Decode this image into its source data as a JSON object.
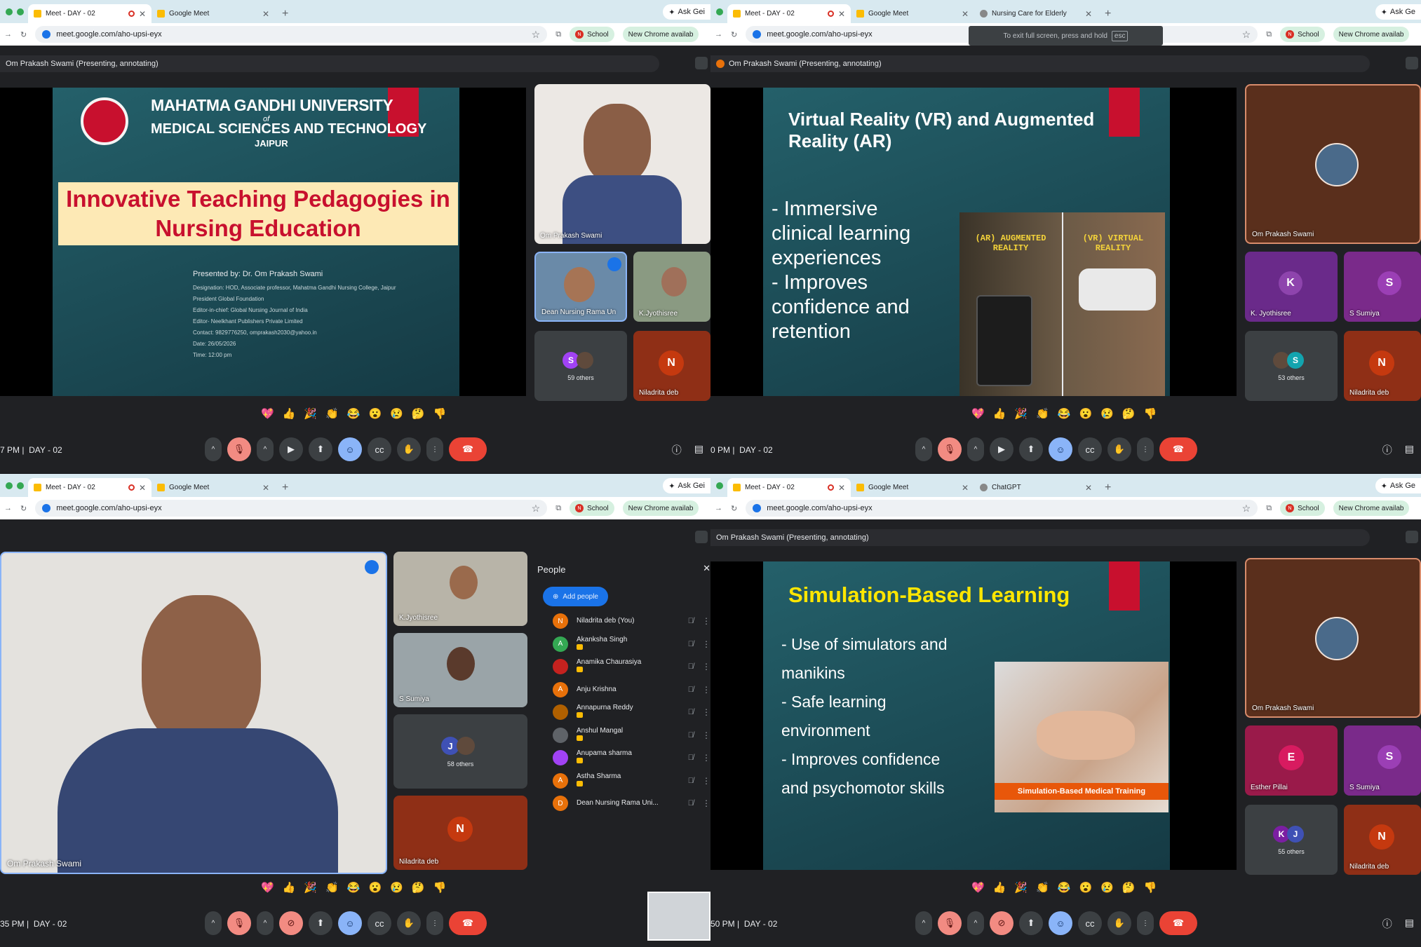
{
  "panes": [
    {
      "tabs": [
        "Meet - DAY - 02",
        "Google Meet"
      ],
      "url": "meet.google.com/aho-upsi-eyx",
      "ask": "Ask Gei",
      "pills": [
        "School",
        "New Chrome availab"
      ],
      "presenting": "Om Prakash Swami (Presenting, annotating)",
      "time": "7 PM",
      "meeting": "DAY - 02",
      "slide": {
        "org1": "MAHATMA GANDHI UNIVERSITY",
        "of": "of",
        "org2": "MEDICAL SCIENCES AND TECHNOLOGY",
        "city": "JAIPUR",
        "title": "Innovative Teaching Pedagogies in Nursing Education",
        "presenter": "Presented by: Dr. Om Prakash Swami",
        "meta": [
          "Designation: HOD, Associate professor, Mahatma Gandhi Nursing College, Jaipur",
          "President Global Foundation",
          "Editor-in-chief: Global Nursing Journal of India",
          "Editor- Neelkhant Publishers Private Limited",
          "Contact: 9829776250, omprakash2030@yahoo.in",
          "Date: 26/05/2026",
          "Time: 12:00 pm"
        ]
      },
      "tiles": {
        "main": "Om Prakash Swami",
        "a": "Dean Nursing Rama Un",
        "b": "K.Jyothisree",
        "others": "59 others",
        "others_letter": "S",
        "n": "Niladrita deb",
        "n_letter": "N"
      }
    },
    {
      "tabs": [
        "Meet - DAY - 02",
        "Google Meet",
        "Nursing Care for Elderly"
      ],
      "url": "meet.google.com/aho-upsi-eyx",
      "ask": "Ask Ge",
      "pills": [
        "School",
        "New Chrome availab"
      ],
      "presenting": "Om Prakash Swami (Presenting, annotating)",
      "time": "0 PM",
      "meeting": "DAY - 02",
      "toast": "To exit full screen, press and hold",
      "toast_key": "esc",
      "slide": {
        "title": "Virtual Reality (VR) and Augmented Reality (AR)",
        "bullets": [
          "- Immersive clinical learning experiences",
          "- Improves confidence and retention"
        ],
        "img_left": "(AR) AUGMENTED REALITY",
        "img_right": "(VR) VIRTUAL REALITY"
      },
      "tiles": {
        "main": "Om Prakash Swami",
        "a": "K. Jyothisree",
        "a_letter": "K",
        "b": "S Sumiya",
        "b_letter": "S",
        "others": "53 others",
        "others_letter": "S",
        "n": "Niladrita deb",
        "n_letter": "N"
      }
    },
    {
      "tabs": [
        "Meet - DAY - 02",
        "Google Meet"
      ],
      "url": "meet.google.com/aho-upsi-eyx",
      "ask": "Ask Gei",
      "pills": [
        "School",
        "New Chrome availab"
      ],
      "time": "35 PM",
      "meeting": "DAY - 02",
      "tiles": {
        "main": "Om Prakash Swami",
        "a": "K.Jyothisree",
        "b": "S Sumiya",
        "others": "58 others",
        "others_letter": "J",
        "n": "Niladrita deb",
        "n_letter": "N"
      },
      "people": {
        "title": "People",
        "add": "Add people",
        "list": [
          {
            "name": "Niladrita deb (You)",
            "letter": "N",
            "color": "#e8710a",
            "host": false
          },
          {
            "name": "Akanksha Singh",
            "letter": "A",
            "color": "#34a853",
            "host": true
          },
          {
            "name": "Anamika Chaurasiya",
            "letter": "",
            "color": "#c5221f",
            "host": true
          },
          {
            "name": "Anju Krishna",
            "letter": "A",
            "color": "#e8710a",
            "host": false
          },
          {
            "name": "Annapurna Reddy",
            "letter": "",
            "color": "#b06000",
            "host": true
          },
          {
            "name": "Anshul Mangal",
            "letter": "",
            "color": "#5f6368",
            "host": true
          },
          {
            "name": "Anupama sharma",
            "letter": "",
            "color": "#a142f4",
            "host": true
          },
          {
            "name": "Astha Sharma",
            "letter": "A",
            "color": "#e8710a",
            "host": true
          },
          {
            "name": "Dean Nursing Rama Uni...",
            "letter": "D",
            "color": "#e8710a",
            "host": false
          }
        ]
      }
    },
    {
      "tabs": [
        "Meet - DAY - 02",
        "Google Meet",
        "ChatGPT"
      ],
      "url": "meet.google.com/aho-upsi-eyx",
      "ask": "Ask Ge",
      "pills": [
        "School",
        "New Chrome availab"
      ],
      "presenting": "Om Prakash Swami (Presenting, annotating)",
      "time": "50 PM",
      "meeting": "DAY - 02",
      "slide": {
        "title": "Simulation-Based Learning",
        "bullets": [
          "- Use of simulators and",
          "manikins",
          "- Safe learning",
          "environment",
          "- Improves confidence",
          "and psychomotor skills"
        ],
        "caption": "Simulation-Based Medical Training"
      },
      "tiles": {
        "main": "Om Prakash Swami",
        "a": "Esther Pillai",
        "a_letter": "E",
        "b": "S Sumiya",
        "b_letter": "S",
        "others": "55 others",
        "others_letter": "K",
        "n": "Niladrita deb",
        "n_letter": "N"
      }
    }
  ],
  "reactions": [
    "💖",
    "👍",
    "🎉",
    "👏",
    "😂",
    "😮",
    "😢",
    "🤔",
    "👎"
  ],
  "colors": {
    "slide_bg": "#1f4f58",
    "accent_red": "#c8102e",
    "title_yellow": "#ffe600",
    "meet_bg": "#202124",
    "end_call": "#ea4335"
  }
}
